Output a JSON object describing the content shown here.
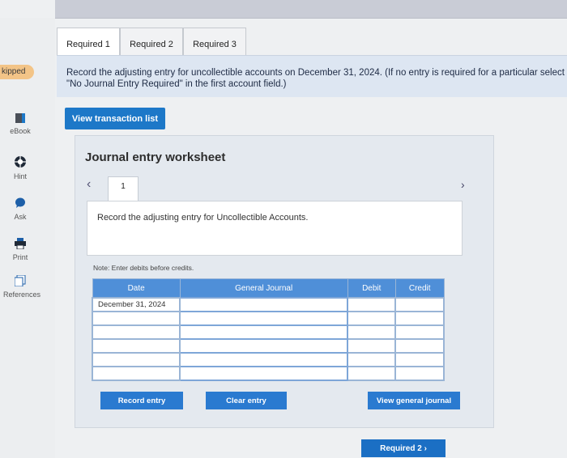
{
  "leftnav": {
    "skipped_label": "kipped",
    "items": [
      {
        "label": "eBook",
        "icon": "book-icon"
      },
      {
        "label": "Hint",
        "icon": "lifebuoy-icon"
      },
      {
        "label": "Ask",
        "icon": "speech-bubble-icon"
      },
      {
        "label": "Print",
        "icon": "printer-icon"
      },
      {
        "label": "References",
        "icon": "document-icon"
      }
    ]
  },
  "tabs": [
    {
      "label": "Required 1",
      "active": true
    },
    {
      "label": "Required 2",
      "active": false
    },
    {
      "label": "Required 3",
      "active": false
    }
  ],
  "instructions": "Record the adjusting entry for uncollectible accounts on December 31, 2024. (If no entry is required for a particular select \"No Journal Entry Required\" in the first account field.)",
  "view_transaction_button": "View transaction list",
  "worksheet": {
    "title": "Journal entry worksheet",
    "entry_number": "1",
    "entry_description": "Record the adjusting entry for Uncollectible Accounts.",
    "note": "Note: Enter debits before credits.",
    "columns": [
      "Date",
      "General Journal",
      "Debit",
      "Credit"
    ],
    "rows": [
      {
        "date": "December 31, 2024",
        "account": "",
        "debit": "",
        "credit": ""
      },
      {
        "date": "",
        "account": "",
        "debit": "",
        "credit": ""
      },
      {
        "date": "",
        "account": "",
        "debit": "",
        "credit": ""
      },
      {
        "date": "",
        "account": "",
        "debit": "",
        "credit": ""
      },
      {
        "date": "",
        "account": "",
        "debit": "",
        "credit": ""
      },
      {
        "date": "",
        "account": "",
        "debit": "",
        "credit": ""
      }
    ],
    "record_button": "Record entry",
    "clear_button": "Clear entry",
    "view_journal_button": "View general journal"
  },
  "next_button": "Required 2",
  "colors": {
    "primary_blue": "#1d78c8",
    "header_blue": "#4f8fd8",
    "skipped_orange": "#f3c487"
  }
}
